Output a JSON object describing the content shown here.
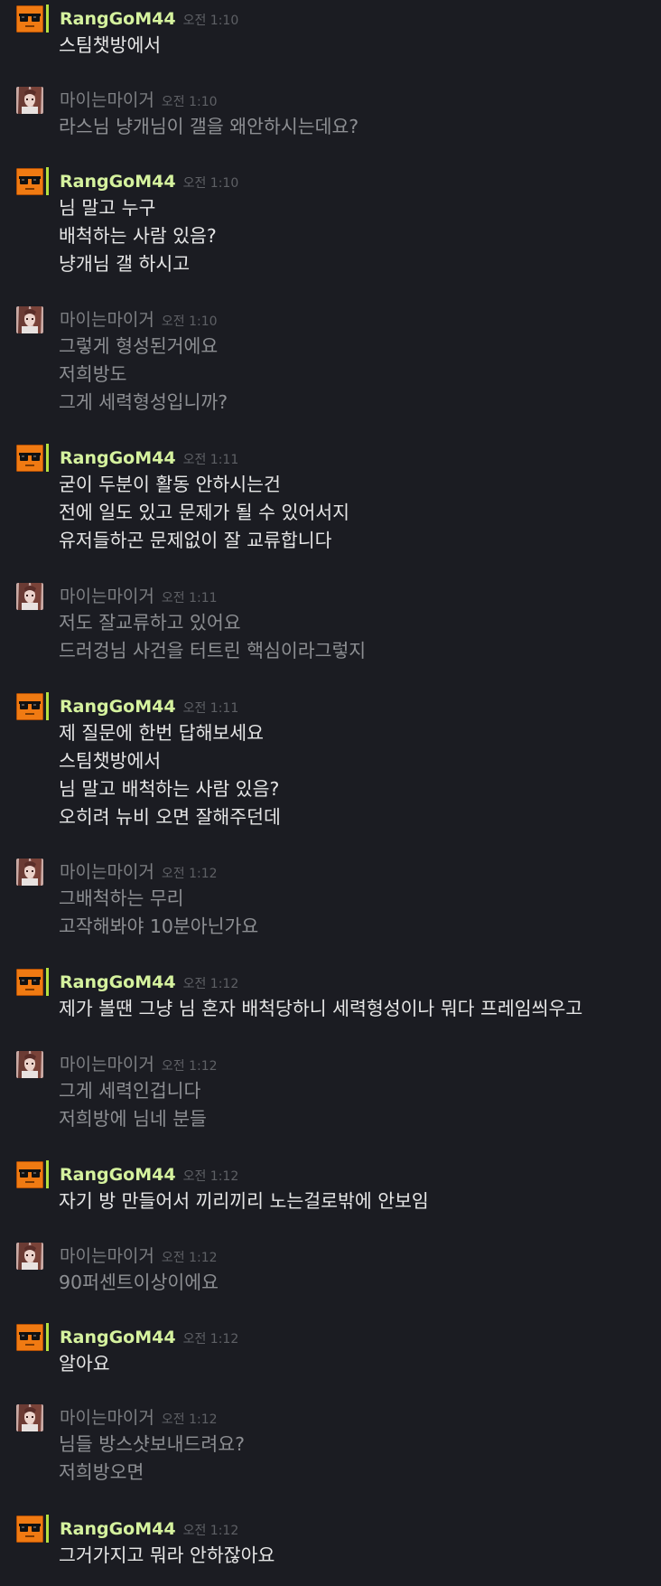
{
  "colors": {
    "background": "#1b1c22",
    "online_name": "#d5f29e",
    "online_bar": "#b6e241",
    "offline_name": "#7d7f83",
    "timestamp": "#5e6065",
    "online_text": "#e6e6e6",
    "offline_text": "#8d8f93"
  },
  "messages": [
    {
      "author": "RangGoM44",
      "time": "오전 1:10",
      "status": "online",
      "avatar": "sunglasses-avatar",
      "lines": [
        "스팀챗방에서"
      ]
    },
    {
      "author": "마이는마이거",
      "time": "오전 1:10",
      "status": "offline",
      "avatar": "anime-girl-avatar",
      "lines": [
        "라스님 냥개님이 갤을 왜안하시는데요?"
      ]
    },
    {
      "author": "RangGoM44",
      "time": "오전 1:10",
      "status": "online",
      "avatar": "sunglasses-avatar",
      "lines": [
        "님 말고 누구",
        "배척하는 사람 있음?",
        "냥개님 갤 하시고"
      ]
    },
    {
      "author": "마이는마이거",
      "time": "오전 1:10",
      "status": "offline",
      "avatar": "anime-girl-avatar",
      "lines": [
        "그렇게 형성된거에요",
        "저희방도",
        "그게 세력형성입니까?"
      ]
    },
    {
      "author": "RangGoM44",
      "time": "오전 1:11",
      "status": "online",
      "avatar": "sunglasses-avatar",
      "lines": [
        "굳이 두분이 활동 안하시는건",
        "전에 일도 있고 문제가 될 수 있어서지",
        "유저들하곤 문제없이 잘 교류합니다"
      ]
    },
    {
      "author": "마이는마이거",
      "time": "오전 1:11",
      "status": "offline",
      "avatar": "anime-girl-avatar",
      "lines": [
        "저도 잘교류하고 있어요",
        "드러겅님 사건을 터트린 핵심이라그렇지"
      ]
    },
    {
      "author": "RangGoM44",
      "time": "오전 1:11",
      "status": "online",
      "avatar": "sunglasses-avatar",
      "lines": [
        "제 질문에 한번 답해보세요",
        "스팀챗방에서",
        "님 말고 배척하는 사람 있음?",
        "오히려 뉴비 오면 잘해주던데"
      ]
    },
    {
      "author": "마이는마이거",
      "time": "오전 1:12",
      "status": "offline",
      "avatar": "anime-girl-avatar",
      "lines": [
        "그배척하는 무리",
        "고작해봐야 10분아닌가요"
      ]
    },
    {
      "author": "RangGoM44",
      "time": "오전 1:12",
      "status": "online",
      "avatar": "sunglasses-avatar",
      "lines": [
        "제가 볼땐 그냥 님 혼자 배척당하니 세력형성이나 뭐다 프레임씌우고"
      ]
    },
    {
      "author": "마이는마이거",
      "time": "오전 1:12",
      "status": "offline",
      "avatar": "anime-girl-avatar",
      "lines": [
        "그게 세력인겁니다",
        "저희방에 님네 분들"
      ]
    },
    {
      "author": "RangGoM44",
      "time": "오전 1:12",
      "status": "online",
      "avatar": "sunglasses-avatar",
      "lines": [
        "자기 방 만들어서 끼리끼리 노는걸로밖에 안보임"
      ]
    },
    {
      "author": "마이는마이거",
      "time": "오전 1:12",
      "status": "offline",
      "avatar": "anime-girl-avatar",
      "lines": [
        "90퍼센트이상이에요"
      ]
    },
    {
      "author": "RangGoM44",
      "time": "오전 1:12",
      "status": "online",
      "avatar": "sunglasses-avatar",
      "lines": [
        "알아요"
      ]
    },
    {
      "author": "마이는마이거",
      "time": "오전 1:12",
      "status": "offline",
      "avatar": "anime-girl-avatar",
      "lines": [
        "님들 방스샷보내드려요?",
        "저희방오면"
      ]
    },
    {
      "author": "RangGoM44",
      "time": "오전 1:12",
      "status": "online",
      "avatar": "sunglasses-avatar",
      "lines": [
        "그거가지고 뭐라 안하잖아요"
      ]
    }
  ]
}
